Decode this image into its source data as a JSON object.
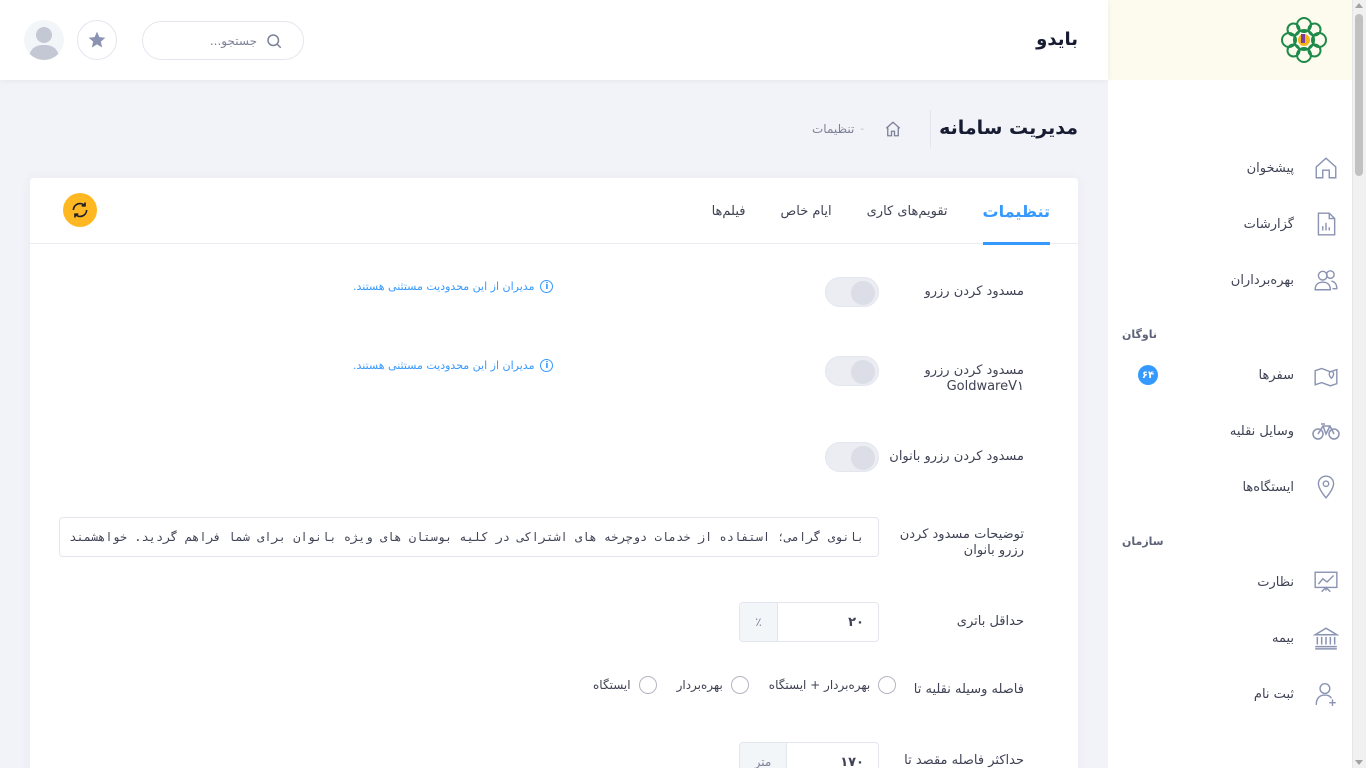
{
  "header": {
    "app_name": "بایدو",
    "search_placeholder": "جستجو..."
  },
  "subheader": {
    "title": "مدیریت سامانه",
    "breadcrumb": [
      "تنظیمات"
    ]
  },
  "sidebar": {
    "items": [
      {
        "label": "پیشخوان",
        "icon": "home-icon"
      },
      {
        "label": "گزارشات",
        "icon": "report-icon"
      },
      {
        "label": "بهره‌برداران",
        "icon": "users-icon"
      }
    ],
    "section_fleet": "ناوگان",
    "fleet_items": [
      {
        "label": "سفرها",
        "icon": "map-pin-route-icon",
        "badge": "۶۴"
      },
      {
        "label": "وسایل نقلیه",
        "icon": "bicycle-icon"
      },
      {
        "label": "ایستگاه‌ها",
        "icon": "location-pin-icon"
      }
    ],
    "section_org": "سازمان",
    "org_items": [
      {
        "label": "نظارت",
        "icon": "chart-board-icon"
      },
      {
        "label": "بیمه",
        "icon": "bank-icon"
      },
      {
        "label": "ثبت نام",
        "icon": "user-add-icon"
      }
    ]
  },
  "tabs": [
    {
      "label": "تنظیمات",
      "active": true
    },
    {
      "label": "تقویم‌های کاری"
    },
    {
      "label": "ایام خاص"
    },
    {
      "label": "فیلم‌ها"
    }
  ],
  "form": {
    "block_reservation": {
      "label": "مسدود کردن رزرو",
      "hint": "مدیران از این محدودیت مستثنی هستند.",
      "enabled": false
    },
    "block_reservation_gw": {
      "label": "مسدود کردن رزرو",
      "label2": "GoldwareV۱",
      "hint": "مدیران از این محدودیت مستثنی هستند.",
      "enabled": false
    },
    "block_women": {
      "label": "مسدود کردن رزرو بانوان",
      "enabled": false
    },
    "block_women_desc": {
      "label": "توضیحات مسدود کردن رزرو بانوان",
      "value": "بانوی گرامی؛ استفاده از خدمات دوچرخه های اشتراکی در کلیه بوستان های ویژه بانوان برای شما فراهم گردید. خواهشمند است بمنظور بهره مندی از خدمات"
    },
    "min_battery": {
      "label": "حداقل باتری",
      "value": "۲۰",
      "unit": "٪"
    },
    "vehicle_distance": {
      "label": "فاصله وسیله نقلیه تا",
      "options": [
        "بهره‌بردار + ایستگاه",
        "بهره‌بردار",
        "ایستگاه"
      ]
    },
    "max_dest_distance": {
      "label": "حداکثر فاصله مقصد تا",
      "value": "۱۷۰",
      "unit": "متر"
    }
  }
}
